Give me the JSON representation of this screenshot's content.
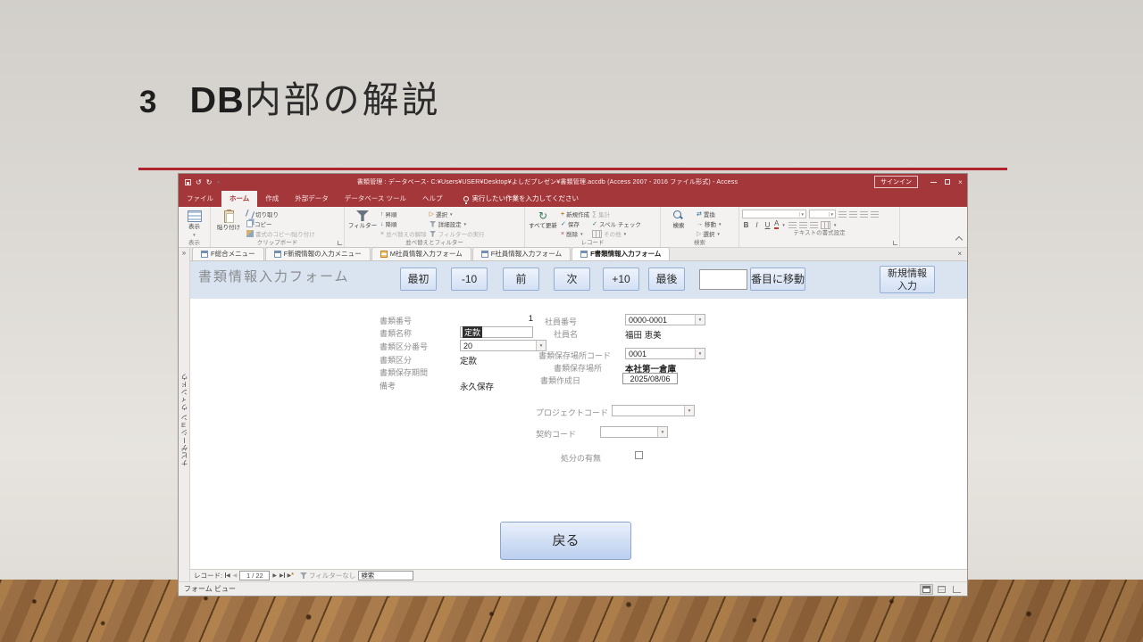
{
  "slide": {
    "number": "3",
    "title_db": "DB",
    "title_rest": "内部の解説"
  },
  "glyphs": {
    "dd": "▼",
    "undo": "↺",
    "redo": "↻",
    "up": "↑",
    "down": "↓",
    "x": "×",
    "sum": "∑",
    "check": "✓",
    "right": "→",
    "cursor": "▷",
    "chev": "»",
    "prev": "◀",
    "next": "▶",
    "star": "*",
    "plus": "+",
    "swap": "⇄",
    "close": "×"
  },
  "titlebar": {
    "title": "書類管理 : データベース- C:¥Users¥USER¥Desktop¥よしだプレゼン¥書類管理.accdb (Access 2007 - 2016 ファイル形式) - Access",
    "signin": "サインイン"
  },
  "menu": {
    "tabs": [
      "ファイル",
      "ホーム",
      "作成",
      "外部データ",
      "データベース ツール",
      "ヘルプ"
    ],
    "tellme": "実行したい作業を入力してください"
  },
  "ribbon": {
    "view": {
      "big": "表示",
      "label": "表示"
    },
    "clipboard": {
      "paste": "貼り付け",
      "cut": "切り取り",
      "copy": "コピー",
      "format_painter": "書式のコピー/貼り付け",
      "label": "クリップボード"
    },
    "sort": {
      "filter": "フィルター",
      "asc": "昇順",
      "desc": "降順",
      "clear": "並べ替えの解除",
      "selection": "選択",
      "advanced": "詳細設定",
      "toggle": "フィルターの実行",
      "label": "並べ替えとフィルター"
    },
    "records": {
      "refresh": "すべて更新",
      "new": "新規作成",
      "save": "保存",
      "delete": "削除",
      "totals": "集計",
      "spelling": "スペル チェック",
      "more": "その他",
      "label": "レコード"
    },
    "find": {
      "find": "検索",
      "replace": "置換",
      "goto": "移動",
      "select": "選択",
      "label": "検索"
    },
    "format": {
      "b": "B",
      "i": "I",
      "u": "U",
      "a": "A",
      "label": "テキストの書式設定"
    }
  },
  "doc_tabs": [
    {
      "label": "F総合メニュー"
    },
    {
      "label": "F新規情報の入力メニュー"
    },
    {
      "label": "M社員情報入力フォーム"
    },
    {
      "label": "F社員情報入力フォーム"
    },
    {
      "label": "F書類情報入力フォーム"
    }
  ],
  "nav_pane": {
    "label": "ナビゲーション ウィンドウ"
  },
  "form": {
    "title": "書類情報入力フォーム",
    "nav": {
      "first": "最初",
      "minus10": "-10",
      "prev": "前",
      "next": "次",
      "plus10": "+10",
      "last": "最後",
      "goto": "番目に移動",
      "new1": "新規情報",
      "new2": "入力"
    },
    "fields": {
      "doc_no_label": "書類番号",
      "doc_no_value": "1",
      "doc_name_label": "書類名称",
      "doc_name_value": "定款",
      "doc_cat_no_label": "書類区分番号",
      "doc_cat_no_value": "20",
      "doc_cat_label": "書類区分",
      "doc_cat_value": "定款",
      "retention_label": "書類保存期間",
      "remarks_label": "備考",
      "remarks_value": "永久保存",
      "emp_no_label": "社員番号",
      "emp_no_value": "0000-0001",
      "emp_name_label": "社員名",
      "emp_name_value": "福田 恵美",
      "loc_code_label": "書類保存場所コード",
      "loc_code_value": "0001",
      "loc_label": "書類保存場所",
      "loc_value": "本社第一倉庫",
      "created_label": "書類作成日",
      "created_value": "2025/08/06",
      "project_label": "プロジェクトコード",
      "contract_label": "契約コード",
      "disposal_label": "処分の有無"
    },
    "back": "戻る"
  },
  "record_bar": {
    "label": "レコード:",
    "position": "1 / 22",
    "filter": "フィルターなし",
    "search": "検索"
  },
  "status_bar": {
    "view": "フォーム ビュー"
  },
  "colors": {
    "accent_red": "#a4373a",
    "line_red": "#b0242f",
    "header_blue": "#d9e4f0"
  }
}
